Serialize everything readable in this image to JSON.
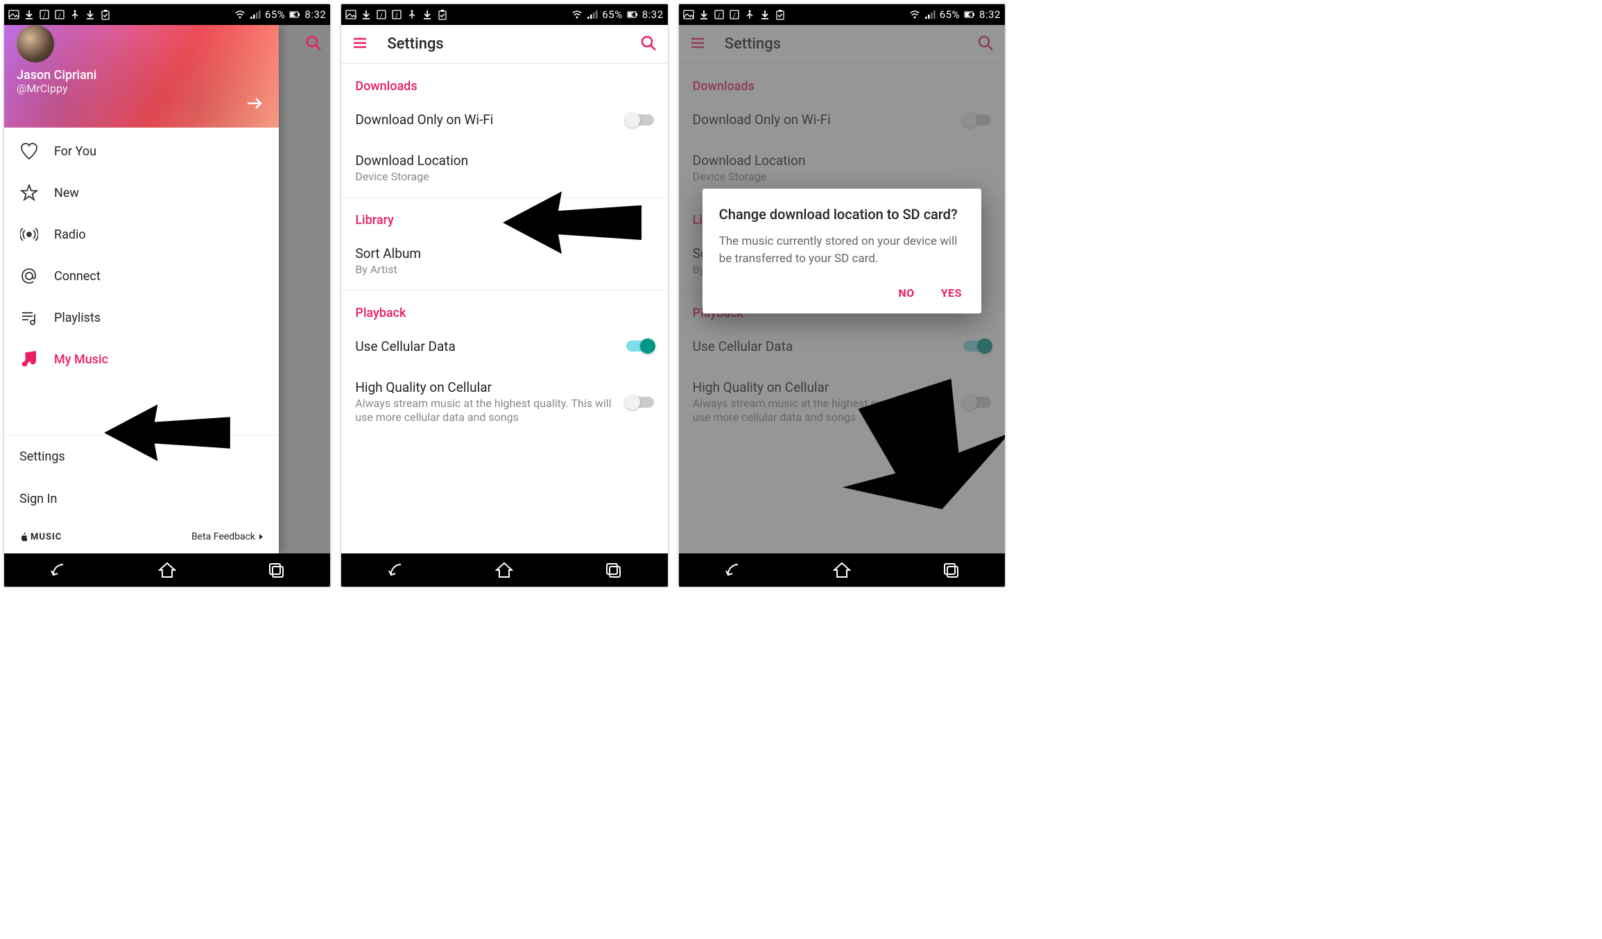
{
  "statusbar": {
    "battery_pct": "65%",
    "time": "8:32"
  },
  "panel1": {
    "profile": {
      "name": "Jason Cipriani",
      "handle": "@MrCippy"
    },
    "drawer_items": [
      {
        "label": "For You"
      },
      {
        "label": "New"
      },
      {
        "label": "Radio"
      },
      {
        "label": "Connect"
      },
      {
        "label": "Playlists"
      },
      {
        "label": "My Music"
      }
    ],
    "lower": {
      "settings": "Settings",
      "signin": "Sign In"
    },
    "footer": {
      "brand": "MUSIC",
      "beta": "Beta Feedback"
    }
  },
  "settings": {
    "header_title": "Settings",
    "sections": {
      "downloads": {
        "label": "Downloads",
        "wifi": {
          "title": "Download Only on Wi-Fi"
        },
        "location": {
          "title": "Download Location",
          "sub": "Device Storage"
        }
      },
      "library": {
        "label": "Library",
        "sort": {
          "title": "Sort Album",
          "sub": "By Artist"
        }
      },
      "playback": {
        "label": "Playback",
        "cell": {
          "title": "Use Cellular Data"
        },
        "hq": {
          "title": "High Quality on Cellular",
          "sub": "Always stream music at the highest quality. This will use more cellular data and songs"
        }
      }
    }
  },
  "dialog": {
    "title": "Change download location to SD card?",
    "body": "The music currently stored on your device will be transferred to your SD card.",
    "no": "NO",
    "yes": "YES"
  }
}
